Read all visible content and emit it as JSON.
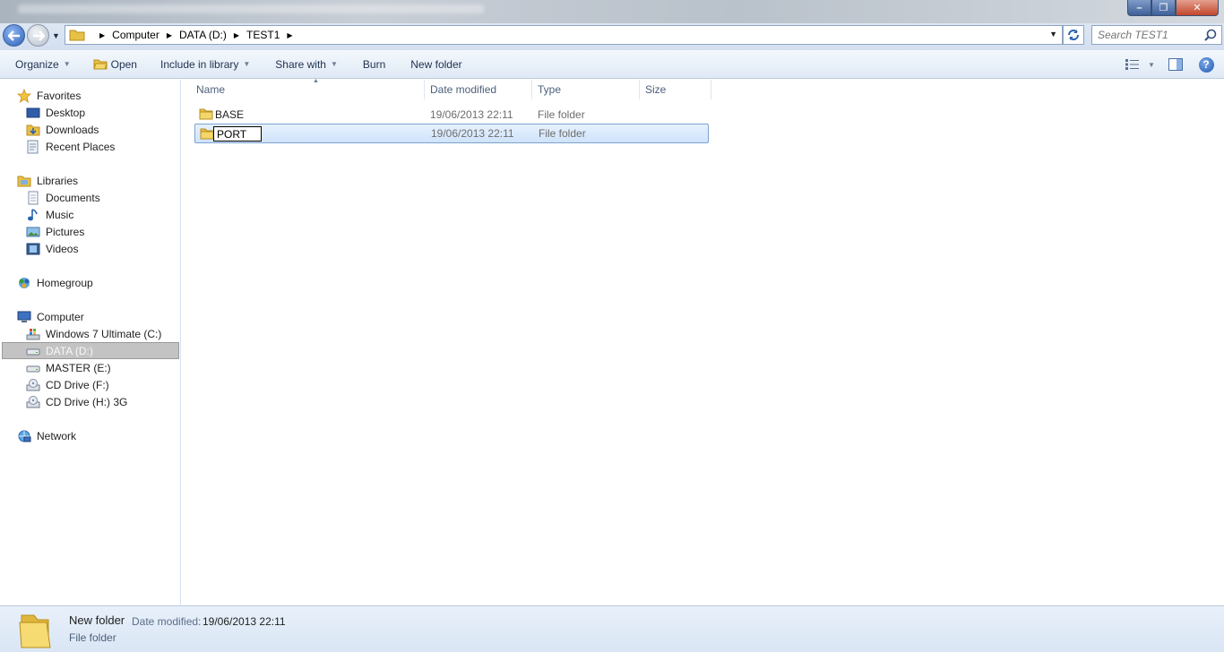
{
  "window": {
    "minimize_glyph": "–",
    "maximize_glyph": "❐",
    "close_glyph": "✕"
  },
  "address": {
    "crumbs": [
      "Computer",
      "DATA (D:)",
      "TEST1"
    ]
  },
  "search": {
    "placeholder": "Search TEST1"
  },
  "toolbar": {
    "organize": "Organize",
    "open": "Open",
    "include_in_library": "Include in library",
    "share_with": "Share with",
    "burn": "Burn",
    "new_folder": "New folder"
  },
  "sidebar": {
    "favorites": {
      "label": "Favorites",
      "items": [
        "Desktop",
        "Downloads",
        "Recent Places"
      ]
    },
    "libraries": {
      "label": "Libraries",
      "items": [
        "Documents",
        "Music",
        "Pictures",
        "Videos"
      ]
    },
    "homegroup": {
      "label": "Homegroup"
    },
    "computer": {
      "label": "Computer",
      "items": [
        "Windows 7 Ultimate (C:)",
        "DATA (D:)",
        "MASTER (E:)",
        "CD Drive (F:)",
        "CD Drive (H:) 3G"
      ],
      "selected": "DATA (D:)"
    },
    "network": {
      "label": "Network"
    }
  },
  "filelist": {
    "columns": [
      "Name",
      "Date modified",
      "Type",
      "Size"
    ],
    "rows": [
      {
        "name": "BASE",
        "date": "19/06/2013 22:11",
        "type": "File folder",
        "size": ""
      },
      {
        "name": "PORT",
        "date": "19/06/2013 22:11",
        "type": "File folder",
        "size": "",
        "renaming": true
      }
    ]
  },
  "details": {
    "name": "New folder",
    "date_label": "Date modified:",
    "date": "19/06/2013 22:11",
    "type": "File folder"
  },
  "colors": {
    "selection_bg": "#cfe3fb",
    "selection_border": "#7da2ce",
    "nav_selected_bg": "#c3c3c3",
    "toolbar_bg": "#dfe9f5",
    "details_bg": "#dae6f5"
  }
}
